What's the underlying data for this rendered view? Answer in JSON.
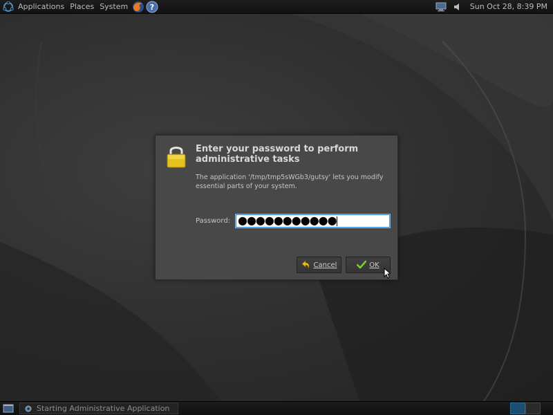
{
  "top_panel": {
    "menus": [
      "Applications",
      "Places",
      "System"
    ],
    "clock": "Sun Oct 28,  8:39 PM"
  },
  "dialog": {
    "title": "Enter your password to perform administrative tasks",
    "message": "The application '/tmp/tmp5sWGb3/gutsy' lets you modify essential parts of your system.",
    "password_label": "Password:",
    "password_value": "●●●●●●●●●●●",
    "cancel_label": "Cancel",
    "ok_label": "OK"
  },
  "bottom_panel": {
    "task_label": "Starting Administrative Application"
  },
  "colors": {
    "panel": "#151515",
    "dialog_bg": "#484848",
    "input_focus": "#3d8fd1",
    "workspace_active": "#1b4e6f"
  }
}
